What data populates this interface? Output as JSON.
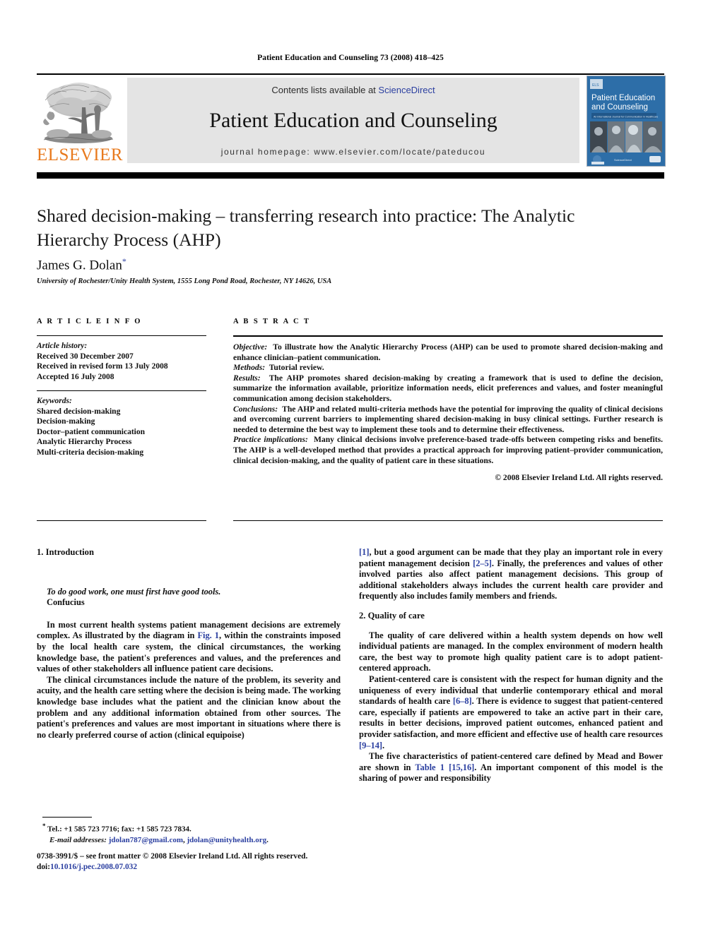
{
  "running_head": "Patient Education and Counseling 73 (2008) 418–425",
  "masthead": {
    "publisher_name": "ELSEVIER",
    "contents_prefix": "Contents lists available at",
    "contents_link": "ScienceDirect",
    "journal_name": "Patient Education and Counseling",
    "homepage": "journal homepage: www.elsevier.com/locate/pateducou",
    "cover": {
      "line1": "Patient Education",
      "line2": "and Counseling",
      "tagline": "An International Journal for Communication in Healthcare",
      "brand": "ScienceDirect"
    },
    "link_color": "#2b3fa0",
    "elsevier_orange": "#E87A1E",
    "panel_gray": "#e4e4e4"
  },
  "title": "Shared decision-making – transferring research into practice: The Analytic Hierarchy Process (AHP)",
  "author": "James G. Dolan",
  "author_marker": "*",
  "affiliation": "University of Rochester/Unity Health System, 1555 Long Pond Road, Rochester, NY 14626, USA",
  "article_info": {
    "heading": "A R T I C L E   I N F O",
    "history_label": "Article history:",
    "history": [
      "Received 30 December 2007",
      "Received in revised form 13 July 2008",
      "Accepted 16 July 2008"
    ],
    "keywords_label": "Keywords:",
    "keywords": [
      "Shared decision-making",
      "Decision-making",
      "Doctor–patient communication",
      "Analytic Hierarchy Process",
      "Multi-criteria decision-making"
    ]
  },
  "abstract": {
    "heading": "A B S T R A C T",
    "sections": [
      {
        "label": "Objective:",
        "text": "To illustrate how the Analytic Hierarchy Process (AHP) can be used to promote shared decision-making and enhance clinician–patient communication."
      },
      {
        "label": "Methods:",
        "text": "Tutorial review."
      },
      {
        "label": "Results:",
        "text": "The AHP promotes shared decision-making by creating a framework that is used to define the decision, summarize the information available, prioritize information needs, elicit preferences and values, and foster meaningful communication among decision stakeholders."
      },
      {
        "label": "Conclusions:",
        "text": "The AHP and related multi-criteria methods have the potential for improving the quality of clinical decisions and overcoming current barriers to implementing shared decision-making in busy clinical settings. Further research is needed to determine the best way to implement these tools and to determine their effectiveness."
      },
      {
        "label": "Practice implications:",
        "text": "Many clinical decisions involve preference-based trade-offs between competing risks and benefits. The AHP is a well-developed method that provides a practical approach for improving patient–provider communication, clinical decision-making, and the quality of patient care in these situations."
      }
    ],
    "copyright": "© 2008 Elsevier Ireland Ltd. All rights reserved."
  },
  "body": {
    "left": {
      "section_heading": "1. Introduction",
      "quote": "To do good work, one must first have good tools.",
      "quote_source": "Confucius",
      "para1_a": "In most current health systems patient management decisions are extremely complex. As illustrated by the diagram in ",
      "para1_ref": "Fig. 1",
      "para1_b": ", within the constraints imposed by the local health care system, the clinical circumstances, the working knowledge base, the patient's preferences and values, and the preferences and values of other stakeholders all influence patient care decisions.",
      "para2": "The clinical circumstances include the nature of the problem, its severity and acuity, and the health care setting where the decision is being made. The working knowledge base includes what the patient and the clinician know about the problem and any additional information obtained from other sources. The patient's preferences and values are most important in situations where there is no clearly preferred course of action (clinical equipoise)"
    },
    "right": {
      "para1_ref1": "[1]",
      "para1_a": ", but a good argument can be made that they play an important role in every patient management decision ",
      "para1_ref2": "[2–5]",
      "para1_b": ". Finally, the preferences and values of other involved parties also affect patient management decisions. This group of additional stakeholders always includes the current health care provider and frequently also includes family members and friends.",
      "section_heading": "2. Quality of care",
      "para2": "The quality of care delivered within a health system depends on how well individual patients are managed. In the complex environment of modern health care, the best way to promote high quality patient care is to adopt patient-centered approach.",
      "para3_a": "Patient-centered care is consistent with the respect for human dignity and the uniqueness of every individual that underlie contemporary ethical and moral standards of health care ",
      "para3_ref1": "[6–8]",
      "para3_b": ". There is evidence to suggest that patient-centered care, especially if patients are empowered to take an active part in their care, results in better decisions, improved patient outcomes, enhanced patient and provider satisfaction, and more efficient and effective use of health care resources ",
      "para3_ref2": "[9–14]",
      "para3_c": ".",
      "para4_a": "The five characteristics of patient-centered care defined by Mead and Bower are shown in ",
      "para4_ref1": "Table 1",
      "para4_mid": " ",
      "para4_ref2": "[15,16]",
      "para4_b": ". An important component of this model is the sharing of power and responsibility"
    }
  },
  "footnote": {
    "marker": "*",
    "tel": " Tel.: +1 585 723 7716; fax: +1 585 723 7834.",
    "email_label": "E-mail addresses:",
    "email1": "jdolan787@gmail.com",
    "email_sep": ", ",
    "email2": "jdolan@unityhealth.org",
    "email_end": "."
  },
  "footer": {
    "issn_line": "0738-3991/$ – see front matter © 2008 Elsevier Ireland Ltd. All rights reserved.",
    "doi_label": "doi:",
    "doi_value": "10.1016/j.pec.2008.07.032"
  }
}
